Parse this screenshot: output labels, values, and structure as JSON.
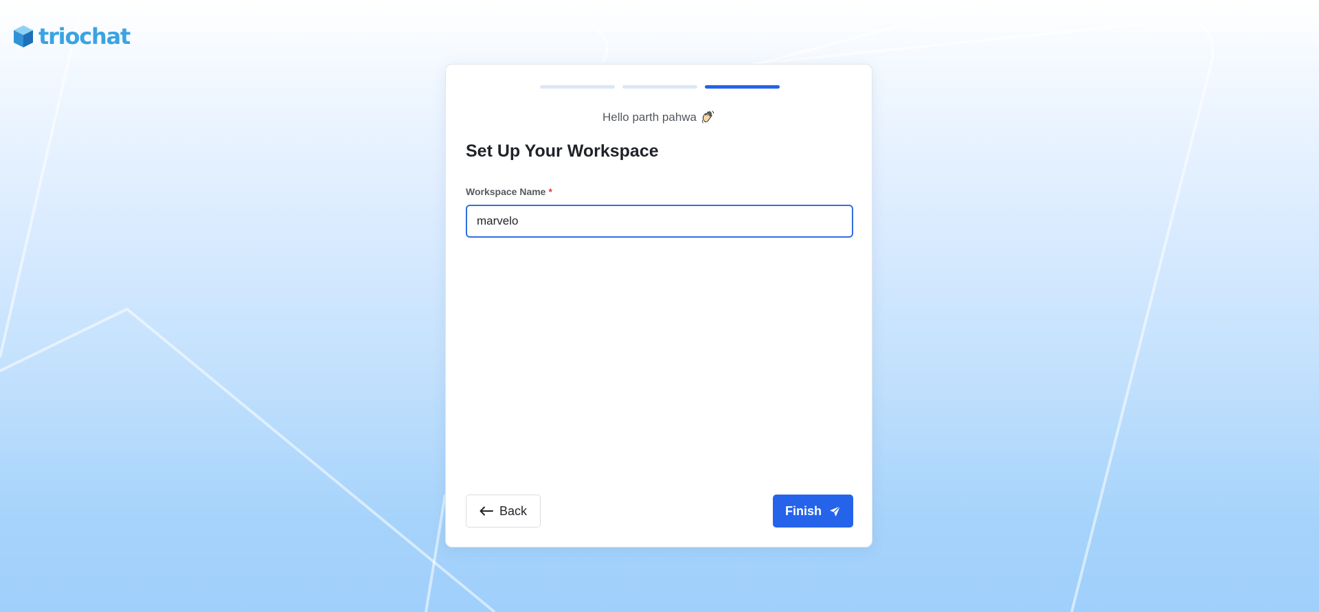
{
  "brand": {
    "name": "triochat",
    "color": "#3aa3e3"
  },
  "progress": {
    "total_steps": 3,
    "current_step": 3,
    "active_color": "#2563eb",
    "inactive_color": "#dbe7f6"
  },
  "greeting": {
    "text": "Hello parth pahwa",
    "emoji_icon": "waving-hand-icon"
  },
  "form": {
    "title": "Set Up Your Workspace",
    "workspace_name": {
      "label": "Workspace Name",
      "required_mark": "*",
      "value": "marvelo"
    }
  },
  "actions": {
    "back": {
      "label": "Back",
      "icon": "arrow-left-icon"
    },
    "finish": {
      "label": "Finish",
      "icon": "send-icon",
      "color": "#2563eb"
    }
  }
}
